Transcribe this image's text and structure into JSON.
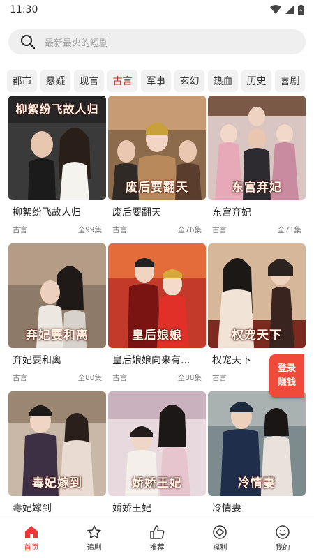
{
  "status": {
    "time": "11:30",
    "icons": [
      "wifi-icon",
      "signal-icon",
      "battery-icon"
    ]
  },
  "search": {
    "placeholder": "最新最火的短剧",
    "icon": "search-icon"
  },
  "categories": [
    "都市",
    "悬疑",
    "现言",
    "古言",
    "军事",
    "玄幻",
    "热血",
    "历史",
    "喜剧"
  ],
  "active_category": "古言",
  "dramas": [
    {
      "title": "柳絮纷飞故人归",
      "tag": "古言",
      "episodes": "全99集",
      "poster_text": "柳絮纷飞故人归"
    },
    {
      "title": "废后要翻天",
      "tag": "古言",
      "episodes": "全76集",
      "poster_text": "废后要翻天"
    },
    {
      "title": "东宫弃妃",
      "tag": "古言",
      "episodes": "全71集",
      "poster_text": "东宫弃妃"
    },
    {
      "title": "弃妃要和离",
      "tag": "古言",
      "episodes": "全80集",
      "poster_text": "弃妃要和离"
    },
    {
      "title": "皇后娘娘向来有...",
      "tag": "古言",
      "episodes": "全88集",
      "poster_text": "皇后娘娘"
    },
    {
      "title": "权宠天下",
      "tag": "古言",
      "episodes": "",
      "poster_text": "权宠天下"
    },
    {
      "title": "毒妃嫁到",
      "tag": "",
      "episodes": "",
      "poster_text": "毒妃嫁到"
    },
    {
      "title": "娇娇王妃",
      "tag": "",
      "episodes": "",
      "poster_text": "娇娇王妃"
    },
    {
      "title": "冷情妻",
      "tag": "",
      "episodes": "",
      "poster_text": "冷情妻"
    }
  ],
  "promo": {
    "line1": "登录",
    "line2": "赚钱"
  },
  "nav": [
    {
      "label": "首页",
      "icon": "home-icon"
    },
    {
      "label": "追剧",
      "icon": "star-icon"
    },
    {
      "label": "推荐",
      "icon": "thumbs-up-icon"
    },
    {
      "label": "福利",
      "icon": "gift-diamond-icon"
    },
    {
      "label": "我的",
      "icon": "smiley-icon"
    }
  ],
  "colors": {
    "accent": "#e53935",
    "active_category": "#c62828",
    "promo_bg": "#f04b3a"
  }
}
